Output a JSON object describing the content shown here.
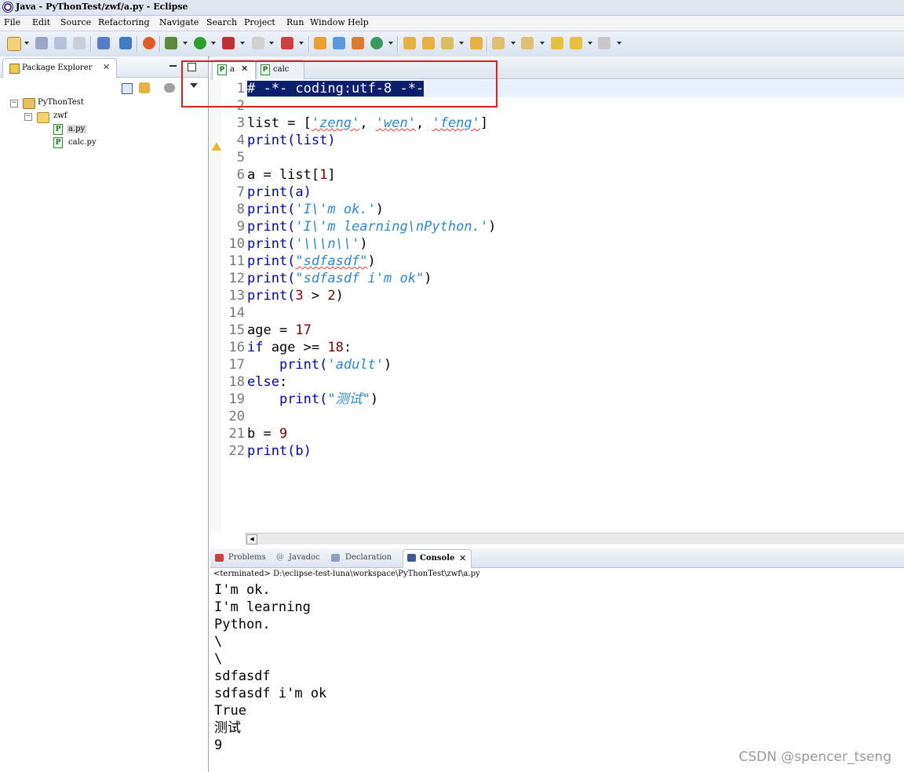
{
  "window": {
    "title": "Java - PyThonTest/zwf/a.py - Eclipse"
  },
  "menu": [
    "File",
    "Edit",
    "Source",
    "Refactoring",
    "Navigate",
    "Search",
    "Project",
    "Run",
    "Window",
    "Help"
  ],
  "package_explorer": {
    "tab_label": "Package Explorer",
    "tree": {
      "project": "PyThonTest",
      "folder": "zwf",
      "files": [
        "a.py",
        "calc.py"
      ]
    }
  },
  "editor": {
    "tabs": [
      "a",
      "calc"
    ],
    "line_numbers": [
      "1",
      "2",
      "3",
      "4",
      "5",
      "6",
      "7",
      "8",
      "9",
      "10",
      "11",
      "12",
      "13",
      "14",
      "15",
      "16",
      "17",
      "18",
      "19",
      "20",
      "21",
      "22"
    ],
    "code": {
      "l1": "# -*- coding:utf-8 -*-",
      "l3_a": "list = [",
      "l3_s1": "'zeng'",
      "l3_c1": ", ",
      "l3_s2": "'wen'",
      "l3_c2": ", ",
      "l3_s3": "'feng'",
      "l3_end": "]",
      "l4": "print(list)",
      "l6_a": "a = list[",
      "l6_n": "1",
      "l6_end": "]",
      "l7": "print(a)",
      "print_open": "print(",
      "close_paren": ")",
      "l8_s": "'I\\'m ok.'",
      "l9_s": "'I\\'m learning\\nPython.'",
      "l10_s": "'\\\\\\n\\\\'",
      "l11_s": "\"sdfasdf\"",
      "l12_s": "\"sdfasdf i'm ok\"",
      "l13_n1": "3",
      "l13_op": " > ",
      "l13_n2": "2",
      "l15_a": "age = ",
      "l15_n": "17",
      "l16_kw": "if",
      "l16_a": " age >= ",
      "l16_n": "18",
      "l16_end": ":",
      "indent": "    ",
      "l17_s": "'adult'",
      "l18_kw": "else",
      "l18_end": ":",
      "l19_s": "\"测试\"",
      "l21_a": "b = ",
      "l21_n": "9",
      "l22": "print(b)"
    }
  },
  "console": {
    "tabs": [
      "Problems",
      "Javadoc",
      "Declaration",
      "Console"
    ],
    "header": "<terminated> D:\\eclipse-test-luna\\workspace\\PyThonTest\\zwf\\a.py",
    "output": [
      "I'm ok.",
      "I'm learning",
      "Python.",
      "\\",
      "\\",
      "sdfasdf",
      "sdfasdf i'm ok",
      "True",
      "测试",
      "9"
    ]
  },
  "watermark": "CSDN @spencer_tseng"
}
